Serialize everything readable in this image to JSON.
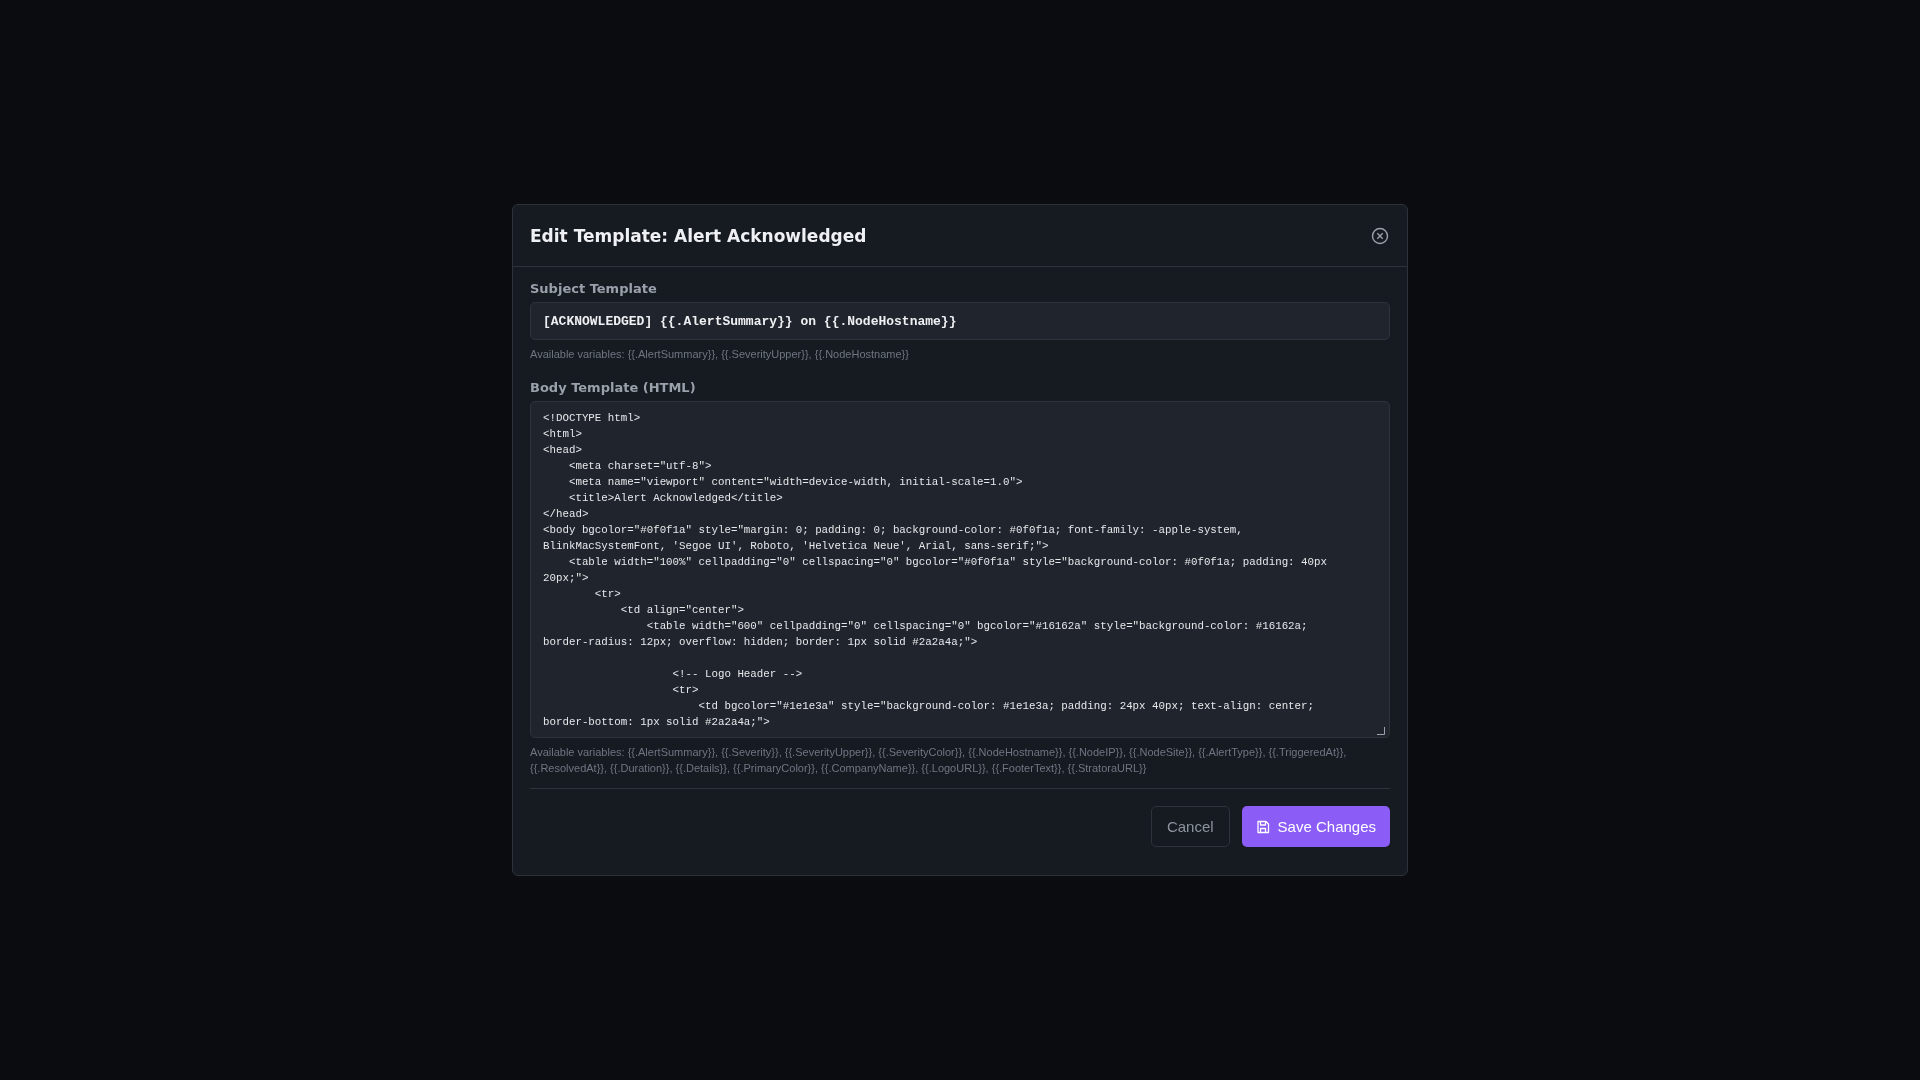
{
  "dialog": {
    "title": "Edit Template: Alert Acknowledged",
    "subject": {
      "label": "Subject Template",
      "value": "[ACKNOWLEDGED] {{.AlertSummary}} on {{.NodeHostname}}",
      "hint": "Available variables: {{.AlertSummary}}, {{.SeverityUpper}}, {{.NodeHostname}}"
    },
    "body": {
      "label": "Body Template (HTML)",
      "value_lines": [
        "<!DOCTYPE html>",
        "<html>",
        "<head>",
        "    <meta charset=\"utf-8\">",
        "    <meta name=\"viewport\" content=\"width=device-width, initial-scale=1.0\">",
        "    <title>Alert Acknowledged</title>",
        "</head>",
        "<body bgcolor=\"#0f0f1a\" style=\"margin: 0; padding: 0; background-color: #0f0f1a; font-family: -apple-system,",
        "BlinkMacSystemFont, 'Segoe UI', Roboto, 'Helvetica Neue', Arial, sans-serif;\">",
        "    <table width=\"100%\" cellpadding=\"0\" cellspacing=\"0\" bgcolor=\"#0f0f1a\" style=\"background-color: #0f0f1a; padding: 40px",
        "20px;\">",
        "        <tr>",
        "            <td align=\"center\">",
        "                <table width=\"600\" cellpadding=\"0\" cellspacing=\"0\" bgcolor=\"#16162a\" style=\"background-color: #16162a;",
        "border-radius: 12px; overflow: hidden; border: 1px solid #2a2a4a;\">\n",
        "                    <!-- Logo Header -->",
        "                    <tr>",
        "                        <td bgcolor=\"#1e1e3a\" style=\"background-color: #1e1e3a; padding: 24px 40px; text-align: center;",
        "border-bottom: 1px solid #2a2a4a;\">"
      ],
      "hint": "Available variables: {{.AlertSummary}}, {{.Severity}}, {{.SeverityUpper}}, {{.SeverityColor}}, {{.NodeHostname}}, {{.NodeIP}}, {{.NodeSite}}, {{.AlertType}}, {{.TriggeredAt}}, {{.ResolvedAt}}, {{.Duration}}, {{.Details}}, {{.PrimaryColor}}, {{.CompanyName}}, {{.LogoURL}}, {{.FooterText}}, {{.StratoraURL}}"
    },
    "buttons": [
      {
        "kind": "secondary",
        "label": "Cancel"
      },
      {
        "kind": "primary",
        "label": "Save Changes"
      }
    ]
  }
}
